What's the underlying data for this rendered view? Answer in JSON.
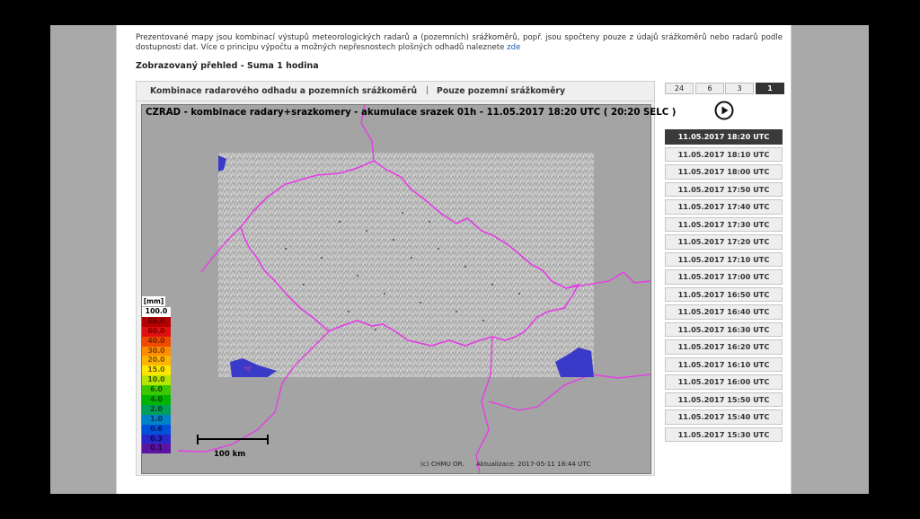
{
  "intro": {
    "text": "Prezentované mapy jsou kombinací výstupů meteorologických radarů a (pozemních) srážkoměrů, popř. jsou spočteny pouze z údajů srážkoměrů nebo radarů podle dostupnosti dat. Více o principu výpočtu a možných nepřesnostech plošných odhadů naleznete",
    "link": "zde"
  },
  "view_title": "Zobrazovaný přehled - Suma 1 hodina",
  "tabs": {
    "combo": "Kombinace radarového odhadu a pozemních srážkoměrů",
    "separator": "|",
    "gauges": "Pouze pozemní srážkoměry"
  },
  "map": {
    "title": "CZRAD - kombinace radary+srazkomery - akumulace srazek 01h - 11.05.2017  18:20 UTC  ( 20:20 SELC )",
    "credit": "(c) CHMU OR.",
    "updated": "Aktualizace: 2017-05-11    18:44 UTC",
    "scale_label": "100 km",
    "colors": {
      "background": "#a4a4a4",
      "border_line": "#e63ce6",
      "relief": "#c9c9c9",
      "precip": "#3a3ac8"
    }
  },
  "legend": {
    "unit": "[mm]",
    "items": [
      {
        "label": "100.0",
        "bg": "#ffffff",
        "fg": "#000000"
      },
      {
        "label": "80.0",
        "bg": "#b30000",
        "fg": "#5a0000"
      },
      {
        "label": "60.0",
        "bg": "#e01010",
        "fg": "#700000"
      },
      {
        "label": "40.0",
        "bg": "#f04a00",
        "fg": "#7a2000"
      },
      {
        "label": "30.0",
        "bg": "#ff8c00",
        "fg": "#804000"
      },
      {
        "label": "20.0",
        "bg": "#ffb400",
        "fg": "#805000"
      },
      {
        "label": "15.0",
        "bg": "#ffe600",
        "fg": "#6a5a00"
      },
      {
        "label": "10.0",
        "bg": "#b4e600",
        "fg": "#405000"
      },
      {
        "label": "6.0",
        "bg": "#3cc800",
        "fg": "#145000"
      },
      {
        "label": "4.0",
        "bg": "#00b400",
        "fg": "#004800"
      },
      {
        "label": "2.0",
        "bg": "#00a05a",
        "fg": "#003c20"
      },
      {
        "label": "1.0",
        "bg": "#0082c8",
        "fg": "#003050"
      },
      {
        "label": "0.6",
        "bg": "#0050dc",
        "fg": "#001e55"
      },
      {
        "label": "0.3",
        "bg": "#2828c8",
        "fg": "#0a0a50"
      },
      {
        "label": "0.1",
        "bg": "#5a14a0",
        "fg": "#1e0640"
      }
    ]
  },
  "sum_buttons": [
    {
      "label": "24",
      "active": false
    },
    {
      "label": "6",
      "active": false
    },
    {
      "label": "3",
      "active": false
    },
    {
      "label": "1",
      "active": true
    }
  ],
  "times": [
    "11.05.2017 18:20 UTC",
    "11.05.2017 18:10 UTC",
    "11.05.2017 18:00 UTC",
    "11.05.2017 17:50 UTC",
    "11.05.2017 17:40 UTC",
    "11.05.2017 17:30 UTC",
    "11.05.2017 17:20 UTC",
    "11.05.2017 17:10 UTC",
    "11.05.2017 17:00 UTC",
    "11.05.2017 16:50 UTC",
    "11.05.2017 16:40 UTC",
    "11.05.2017 16:30 UTC",
    "11.05.2017 16:20 UTC",
    "11.05.2017 16:10 UTC",
    "11.05.2017 16:00 UTC",
    "11.05.2017 15:50 UTC",
    "11.05.2017 15:40 UTC",
    "11.05.2017 15:30 UTC"
  ],
  "active_time_index": 0,
  "play_icon": "play-circle-icon"
}
